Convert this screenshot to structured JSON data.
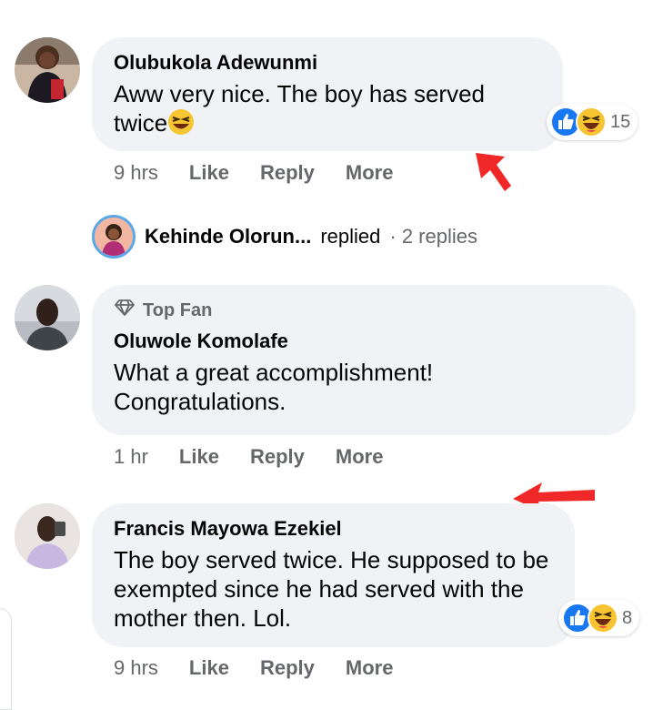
{
  "comments": [
    {
      "author": "Olubukola Adewunmi",
      "text": "Aww very nice. The boy has served twice",
      "time": "9 hrs",
      "reaction_count": "15"
    },
    {
      "badge": "Top Fan",
      "author": "Oluwole Komolafe",
      "text": "What a great accomplishment! Congratulations.",
      "time": "1 hr"
    },
    {
      "author": "Francis Mayowa Ezekiel",
      "text": "The boy served twice. He supposed to be exempted since he had served with the mother then. Lol.",
      "time": "9 hrs",
      "reaction_count": "8"
    }
  ],
  "reply_thread": {
    "name": "Kehinde Olorun...",
    "verb": "replied",
    "count": "· 2 replies"
  },
  "actions": {
    "like": "Like",
    "reply": "Reply",
    "more": "More"
  },
  "colors": {
    "bubble": "#f0f2f5",
    "secondary_text": "#65676b",
    "like_blue": "#1877f2",
    "annotation_arrow": "#f02828"
  },
  "icons": [
    "like-reaction-icon",
    "haha-reaction-icon",
    "laughing-emoji-icon",
    "diamond-icon",
    "red-arrow-annotation"
  ]
}
